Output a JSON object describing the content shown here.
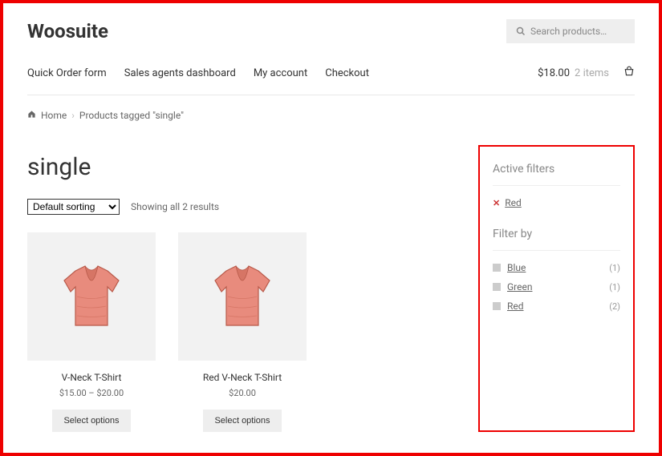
{
  "brand": "Woosuite",
  "search": {
    "placeholder": "Search products…"
  },
  "nav": {
    "items": [
      "Quick Order form",
      "Sales agents dashboard",
      "My account",
      "Checkout"
    ]
  },
  "cart": {
    "total": "$18.00",
    "count_label": "2 items"
  },
  "breadcrumb": {
    "home": "Home",
    "current": "Products tagged \"single\""
  },
  "page": {
    "title": "single"
  },
  "sort": {
    "selected": "Default sorting",
    "result_text": "Showing all 2 results"
  },
  "products": [
    {
      "name": "V-Neck T-Shirt",
      "price": "$15.00 – $20.00",
      "button": "Select options"
    },
    {
      "name": "Red V-Neck T-Shirt",
      "price": "$20.00",
      "button": "Select options"
    }
  ],
  "sidebar": {
    "active_title": "Active filters",
    "active": [
      {
        "label": "Red"
      }
    ],
    "filter_title": "Filter by",
    "filters": [
      {
        "label": "Blue",
        "count": "(1)",
        "checked": false
      },
      {
        "label": "Green",
        "count": "(1)",
        "checked": false
      },
      {
        "label": "Red",
        "count": "(2)",
        "checked": true
      }
    ]
  }
}
